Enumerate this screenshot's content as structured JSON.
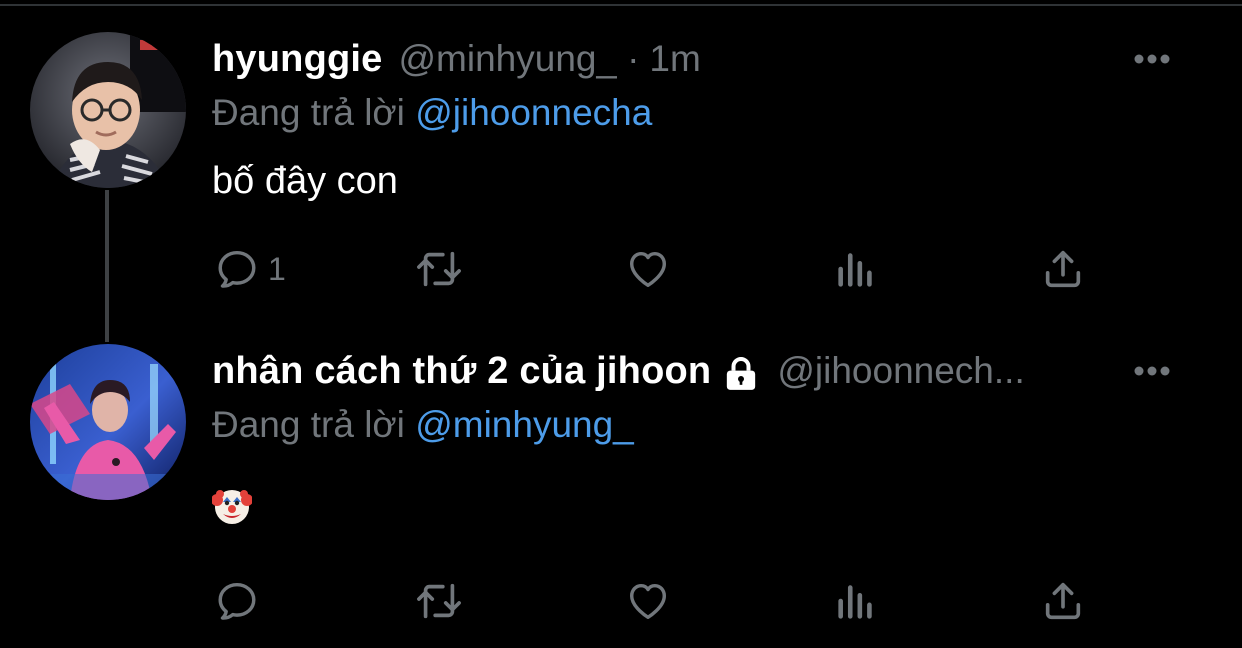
{
  "thread": [
    {
      "display_name": "hyunggie",
      "handle": "@minhyung_",
      "separator": "·",
      "time": "1m",
      "reply_prefix": "Đang trả lời",
      "reply_to": "@jihoonnecha",
      "text": "bố đây con",
      "protected": false,
      "actions": {
        "reply_count": "1",
        "reply_icon": "reply-icon",
        "retweet_icon": "retweet-icon",
        "like_icon": "heart-icon",
        "stats_icon": "stats-icon",
        "share_icon": "share-icon"
      }
    },
    {
      "display_name": "nhân cách thứ 2 của jihoon",
      "handle": "@jihoonnech...",
      "reply_prefix": "Đang trả lời",
      "reply_to": "@minhyung_",
      "text_emoji": "clown-face-emoji",
      "protected": true,
      "lock_icon": "lock-icon",
      "actions": {
        "reply_count": "",
        "reply_icon": "reply-icon",
        "retweet_icon": "retweet-icon",
        "like_icon": "heart-icon",
        "stats_icon": "stats-icon",
        "share_icon": "share-icon"
      }
    }
  ],
  "colors": {
    "background": "#000000",
    "name": "#ffffff",
    "secondary": "#71767b",
    "mention": "#4d9ce9",
    "thread_line": "#3e4144"
  }
}
